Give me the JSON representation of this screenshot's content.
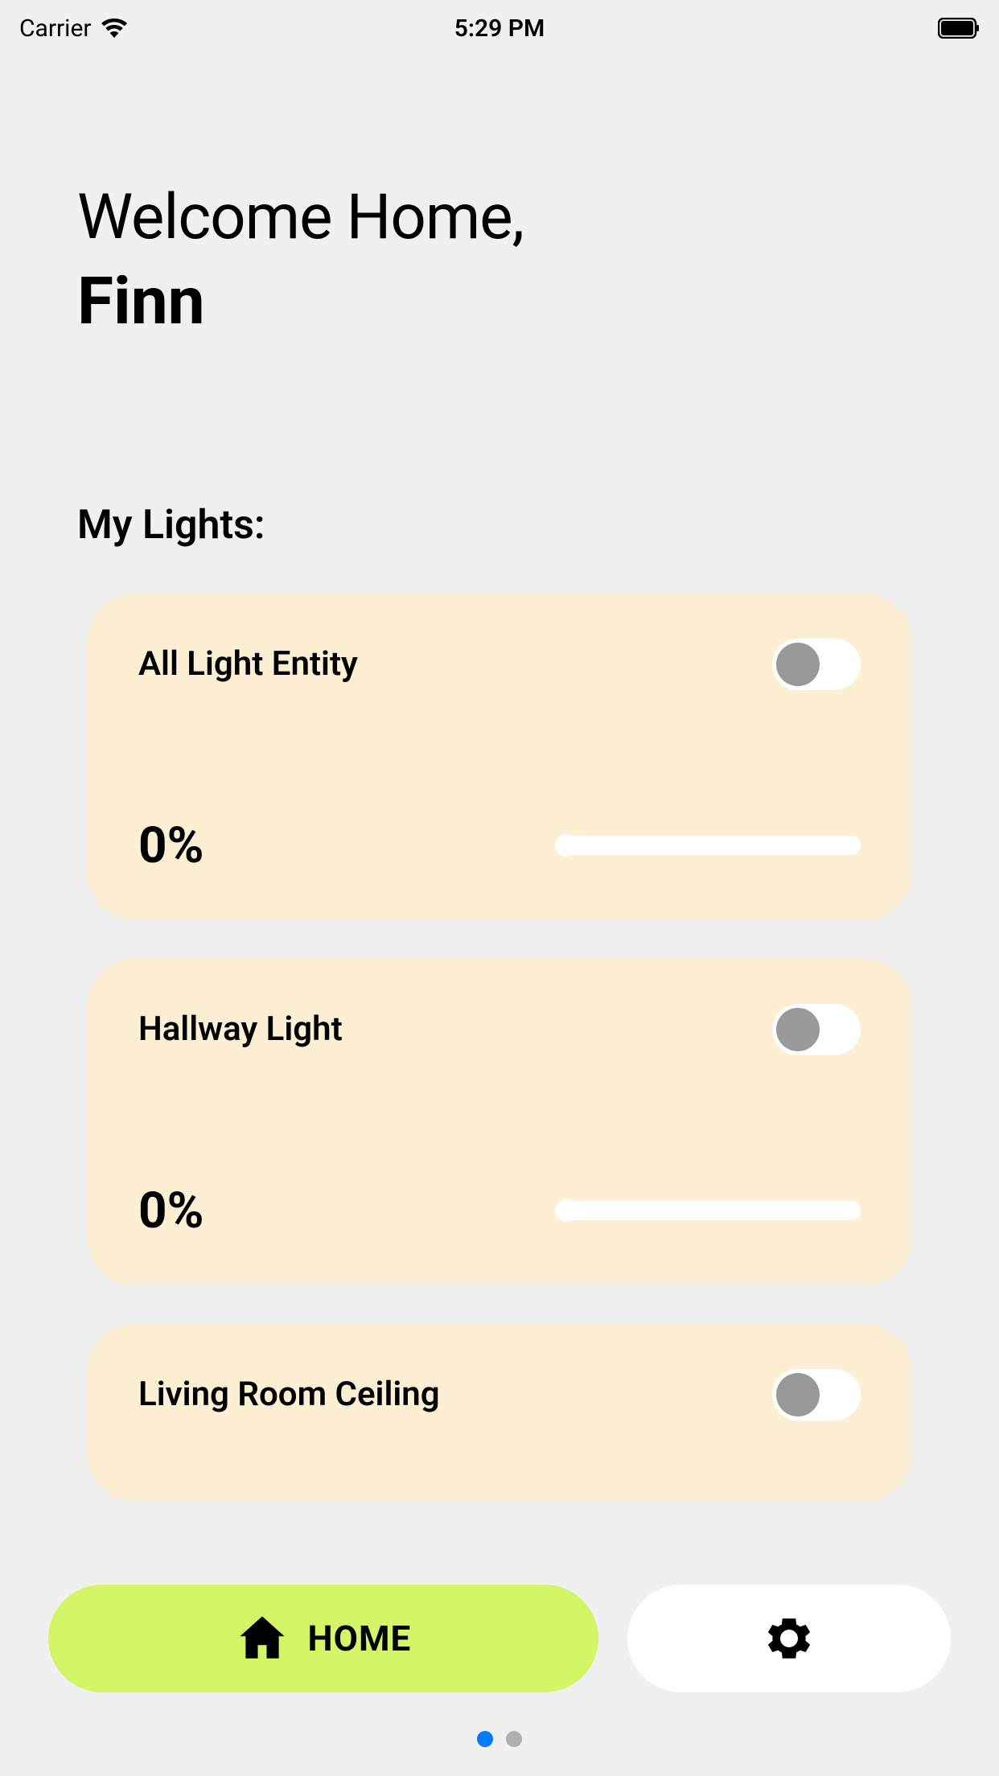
{
  "statusBar": {
    "carrier": "Carrier",
    "time": "5:29 PM"
  },
  "header": {
    "welcomeLabel": "Welcome Home,",
    "userName": "Finn"
  },
  "sectionTitle": "My Lights:",
  "lights": [
    {
      "name": "All Light Entity",
      "brightness": "0%",
      "toggleOn": false
    },
    {
      "name": "Hallway Light",
      "brightness": "0%",
      "toggleOn": false
    },
    {
      "name": "Living Room Ceiling",
      "toggleOn": false
    }
  ],
  "nav": {
    "homeLabel": "HOME"
  }
}
